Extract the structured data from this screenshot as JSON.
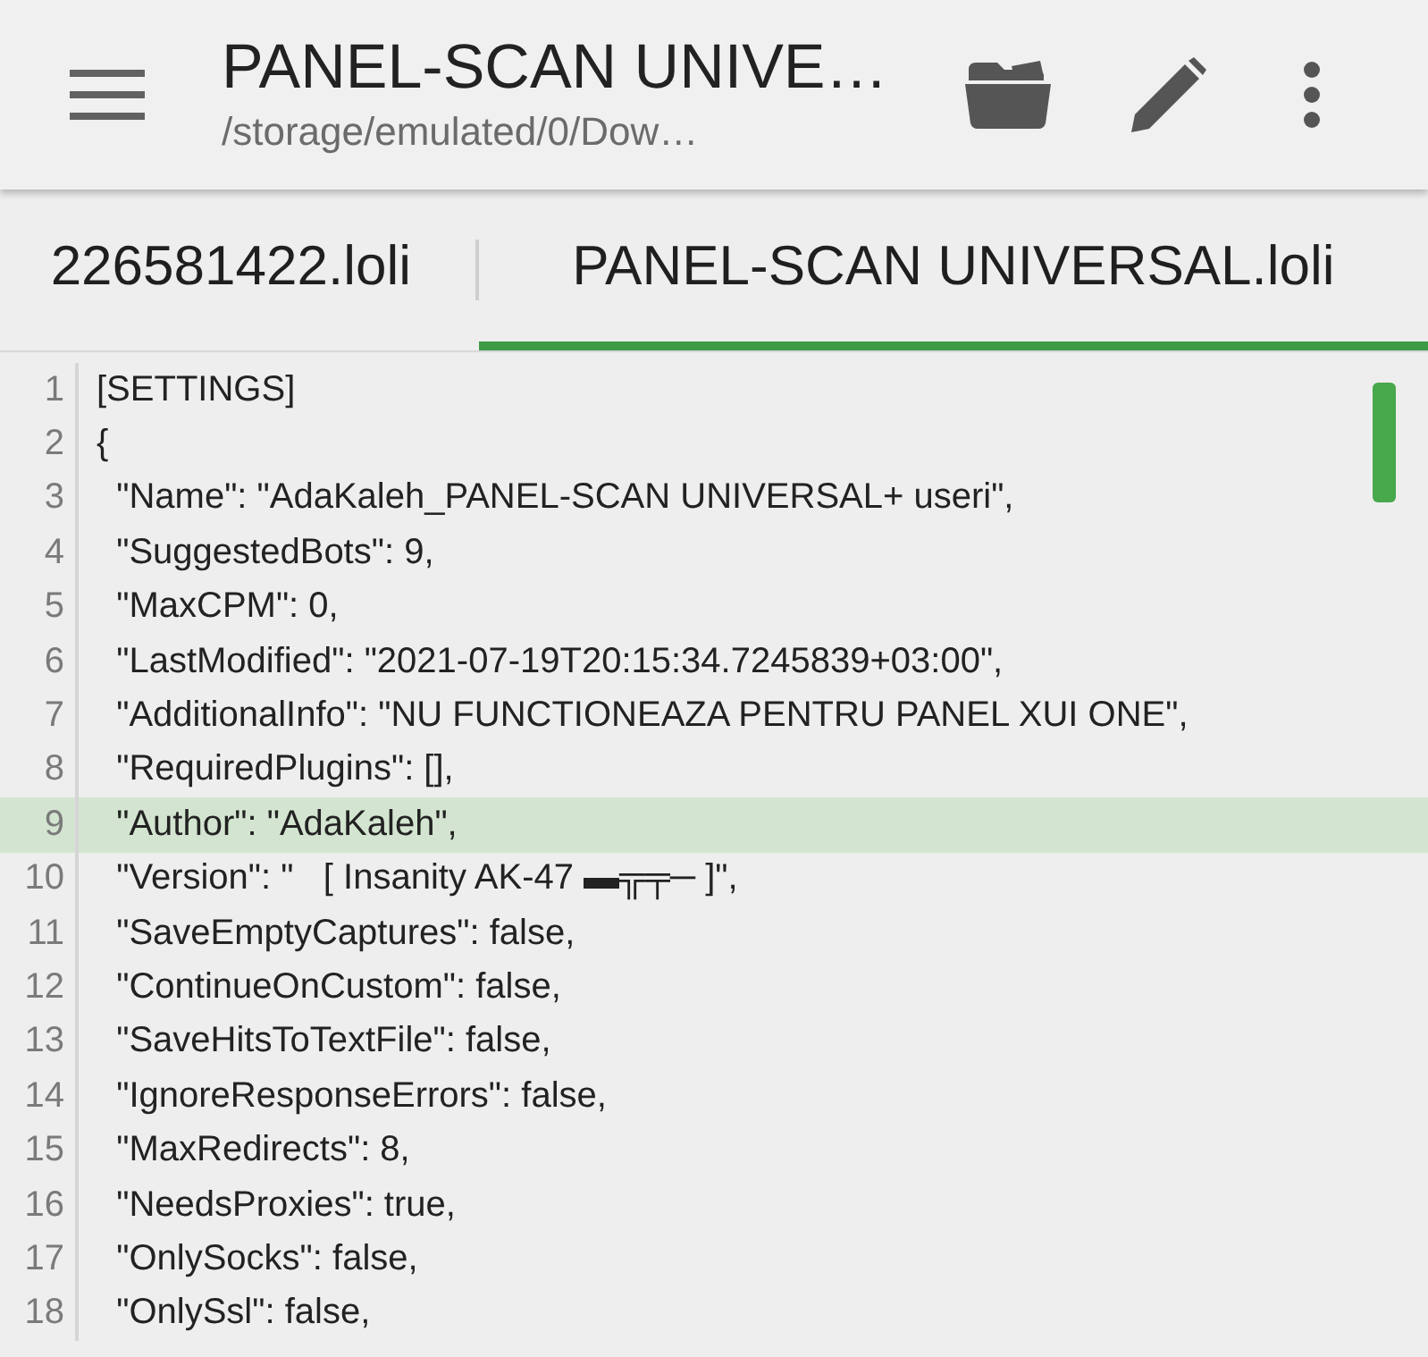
{
  "app_bar": {
    "title": "PANEL-SCAN UNIVE…",
    "subtitle": "/storage/emulated/0/Dow…"
  },
  "tabs": [
    {
      "label": "226581422.loli",
      "selected": false
    },
    {
      "label": "PANEL-SCAN UNIVERSAL.loli",
      "selected": true
    }
  ],
  "editor": {
    "lines": [
      {
        "number": "1",
        "text": "[SETTINGS]",
        "highlighted": false
      },
      {
        "number": "2",
        "text": "{",
        "highlighted": false
      },
      {
        "number": "3",
        "text": "  \"Name\": \"AdaKaleh_PANEL-SCAN UNIVERSAL+ useri\",",
        "highlighted": false
      },
      {
        "number": "4",
        "text": "  \"SuggestedBots\": 9,",
        "highlighted": false
      },
      {
        "number": "5",
        "text": "  \"MaxCPM\": 0,",
        "highlighted": false
      },
      {
        "number": "6",
        "text": "  \"LastModified\": \"2021-07-19T20:15:34.7245839+03:00\",",
        "highlighted": false
      },
      {
        "number": "7",
        "text": "  \"AdditionalInfo\": \"NU FUNCTIONEAZA PENTRU PANEL XUI ONE\",",
        "highlighted": false
      },
      {
        "number": "8",
        "text": "  \"RequiredPlugins\": [],",
        "highlighted": false
      },
      {
        "number": "9",
        "text": "  \"Author\": \"AdaKaleh\",",
        "highlighted": true
      },
      {
        "number": "10",
        "text": "  \"Version\": \"   [ Insanity AK-47 ▬╦╤─ ]\",",
        "highlighted": false
      },
      {
        "number": "11",
        "text": "  \"SaveEmptyCaptures\": false,",
        "highlighted": false
      },
      {
        "number": "12",
        "text": "  \"ContinueOnCustom\": false,",
        "highlighted": false
      },
      {
        "number": "13",
        "text": "  \"SaveHitsToTextFile\": false,",
        "highlighted": false
      },
      {
        "number": "14",
        "text": "  \"IgnoreResponseErrors\": false,",
        "highlighted": false
      },
      {
        "number": "15",
        "text": "  \"MaxRedirects\": 8,",
        "highlighted": false
      },
      {
        "number": "16",
        "text": "  \"NeedsProxies\": true,",
        "highlighted": false
      },
      {
        "number": "17",
        "text": "  \"OnlySocks\": false,",
        "highlighted": false
      },
      {
        "number": "18",
        "text": "  \"OnlySsl\": false,",
        "highlighted": false
      }
    ]
  }
}
